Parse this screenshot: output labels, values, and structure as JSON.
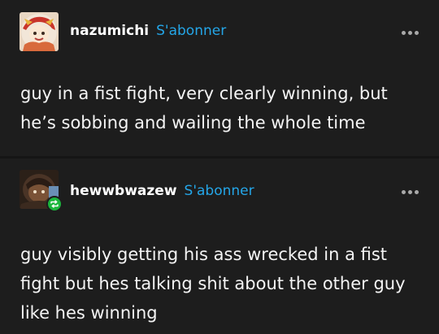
{
  "posts": [
    {
      "username": "nazumichi",
      "follow_label": "S'abonner",
      "more_icon": "more-horizontal-icon",
      "avatar": "user-avatar",
      "text": "guy in a fist fight, very clearly winning, but he’s sobbing and wailing the whole time"
    },
    {
      "username": "hewwbwazew",
      "follow_label": "S'abonner",
      "more_icon": "more-horizontal-icon",
      "avatar": "user-avatar",
      "reblog_icon": "reblog-icon",
      "text": "guy visibly getting his ass wrecked in a fist fight but hes talking shit about the other guy like hes winning"
    }
  ],
  "colors": {
    "background": "#1d1d1d",
    "follow_link": "#24a6e8",
    "reblog_badge": "#1bb63c",
    "text": "#f4f4f4"
  }
}
